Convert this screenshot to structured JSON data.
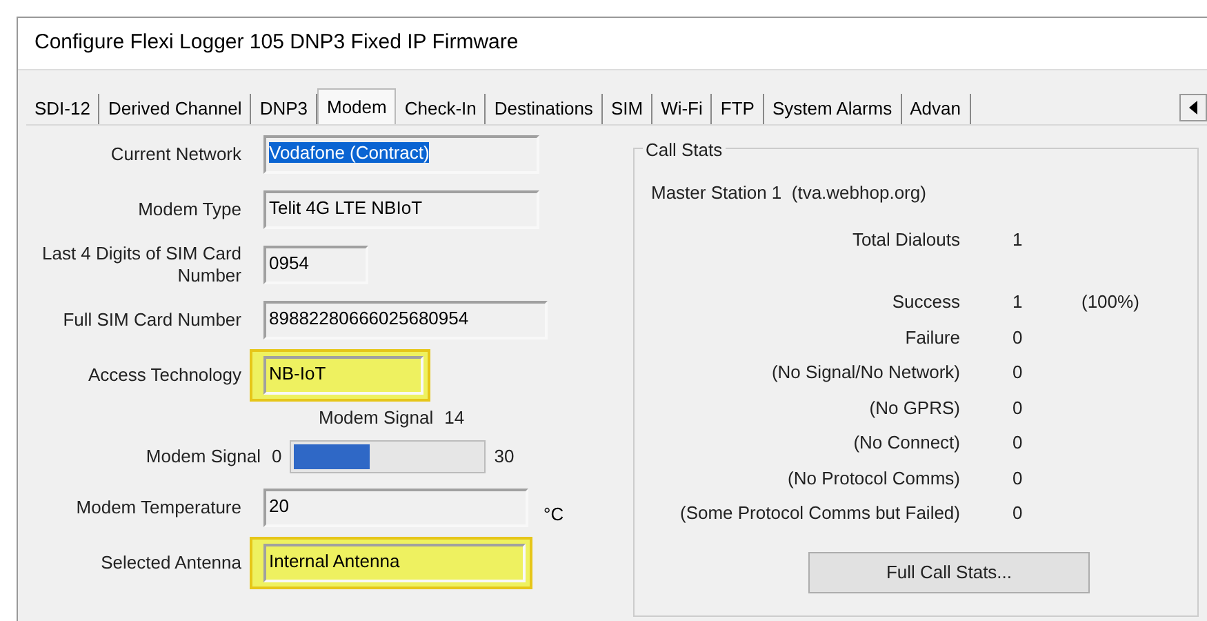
{
  "window": {
    "title": "Configure Flexi Logger 105 DNP3 Fixed IP Firmware"
  },
  "tabs": [
    {
      "label": "SDI-12",
      "selected": false
    },
    {
      "label": "Derived Channel",
      "selected": false
    },
    {
      "label": "DNP3",
      "selected": false
    },
    {
      "label": "Modem",
      "selected": true
    },
    {
      "label": "Check-In",
      "selected": false
    },
    {
      "label": "Destinations",
      "selected": false
    },
    {
      "label": "SIM",
      "selected": false
    },
    {
      "label": "Wi-Fi",
      "selected": false
    },
    {
      "label": "FTP",
      "selected": false
    },
    {
      "label": "System Alarms",
      "selected": false
    },
    {
      "label": "Advan",
      "selected": false
    }
  ],
  "modem": [
    {
      "kind": "field",
      "label": "Current Network",
      "value": "Vodafone (Contract)",
      "highlighted": false,
      "text_selected": true
    },
    {
      "kind": "field",
      "label": "Modem Type",
      "value": "Telit 4G LTE NBIoT",
      "highlighted": false,
      "text_selected": false
    },
    {
      "kind": "field",
      "label": "Last 4 Digits of SIM Card Number",
      "value": "0954",
      "highlighted": false,
      "text_selected": false
    },
    {
      "kind": "field",
      "label": "Full SIM Card Number",
      "value": "89882280666025680954",
      "highlighted": false,
      "text_selected": false
    },
    {
      "kind": "field",
      "label": "Access Technology",
      "value": "NB-IoT",
      "highlighted": true,
      "text_selected": false
    },
    {
      "kind": "reading",
      "label": "Modem Signal",
      "value": "14"
    },
    {
      "kind": "meter",
      "label": "Modem Signal",
      "min": "0",
      "max": "30",
      "level": 0.4
    },
    {
      "kind": "field",
      "label": "Modem Temperature",
      "value": "20",
      "unit": "°C",
      "highlighted": false,
      "text_selected": false
    },
    {
      "kind": "field",
      "label": "Selected Antenna",
      "value": "Internal Antenna",
      "highlighted": true,
      "text_selected": false
    }
  ],
  "call_stats": {
    "title": "Call Stats",
    "station": "Master Station 1  (tva.webhop.org)",
    "rows": [
      {
        "label": "Total Dialouts",
        "value": "1"
      },
      {
        "label": "Success",
        "value": "1",
        "percent": "(100%)"
      },
      {
        "label": "Failure",
        "value": "0"
      },
      {
        "label": "(No Signal/No Network)",
        "value": "0"
      },
      {
        "label": "(No GPRS)",
        "value": "0"
      },
      {
        "label": "(No Connect)",
        "value": "0"
      },
      {
        "label": "(No Protocol Comms)",
        "value": "0"
      },
      {
        "label": "(Some Protocol Comms but Failed)",
        "value": "0"
      }
    ],
    "button": "Full Call Stats..."
  }
}
